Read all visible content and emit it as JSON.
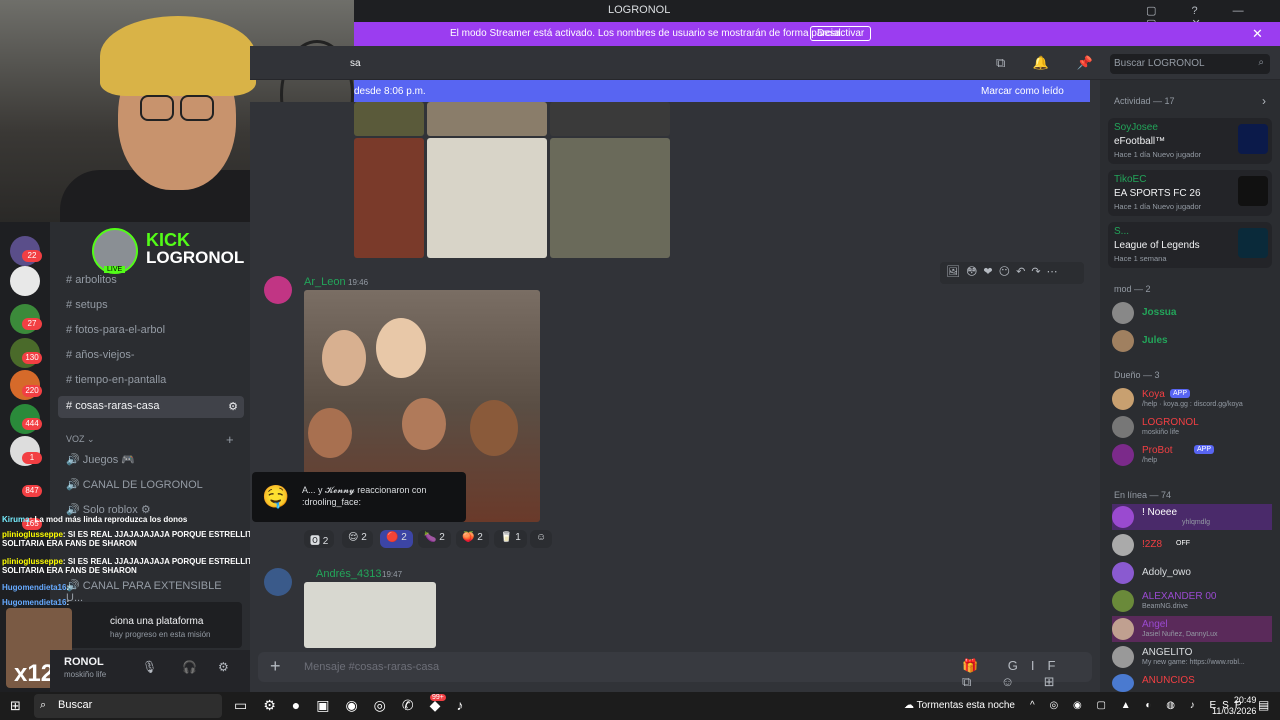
{
  "window": {
    "title": "LOGRONOL",
    "controls": [
      "▢",
      "?",
      "—",
      "▢",
      "✕"
    ]
  },
  "streamer_banner": {
    "message": "El modo Streamer está activado. Los nombres de usuario se mostrarán de forma parcial.",
    "button": "Desactivar",
    "close": "✕"
  },
  "header": {
    "channel_fragment": "sa",
    "search_placeholder": "Buscar LOGRONOL"
  },
  "new_messages_bar": {
    "left": "desde 8:06 p.m.",
    "right": "Marcar como leído"
  },
  "kick_overlay": {
    "brand": "KICK",
    "name": "LOGRONOL",
    "live": "LIVE"
  },
  "server_badges": [
    "22",
    "",
    "27",
    "130",
    "220",
    "444",
    "1",
    "847",
    "165"
  ],
  "channels": [
    {
      "name": "arbolitos",
      "icon": "#"
    },
    {
      "name": "setups",
      "icon": "#"
    },
    {
      "name": "fotos-para-el-arbol",
      "icon": "#"
    },
    {
      "name": "años-viejos-",
      "icon": "#"
    },
    {
      "name": "tiempo-en-pantalla",
      "icon": "#"
    },
    {
      "name": "cosas-raras-casa",
      "icon": "#",
      "selected": true
    }
  ],
  "voice_category": "VOZ",
  "voice_channels": [
    "Juegos 🎮",
    "CANAL DE LOGRONOL",
    "Solo roblox ⚙",
    "CANAL PARA EXTENSIBLE U..."
  ],
  "overlay_chat": [
    {
      "user": "Kiruma",
      "text": ": La mod más linda reproduzca los donos"
    },
    {
      "user": "plinioglusseppe",
      "text": ": SI ES REAL JJAJAJAJAJA PORQUE ESTRELLITA SOLITARIA ERA FANS DE SHARON"
    },
    {
      "user": "plinioglusseppe",
      "text": ": SI ES REAL JJAJAJAJAJA PORQUE ESTRELLITA SOLITARIA ERA FANS DE SHARON"
    },
    {
      "user": "Hugomendieta16",
      "text": ": "
    },
    {
      "user": "Hugomendieta16",
      "text": ": "
    }
  ],
  "mission": {
    "title": "ciona una plataforma",
    "sub": "hay progreso en esta misión",
    "multiplier": "x12"
  },
  "user_panel": {
    "name": "RONOL",
    "status": "moskiño life"
  },
  "messages": [
    {
      "author": "Ar_Leon",
      "time": "19:46"
    },
    {
      "author": "Andrés_4313",
      "time": "19:47"
    }
  ],
  "reactions": [
    {
      "emoji": "🅾",
      "count": "2"
    },
    {
      "emoji": "😌",
      "count": "2"
    },
    {
      "emoji": "🔴",
      "count": "2"
    },
    {
      "emoji": "🍆",
      "count": "2"
    },
    {
      "emoji": "🍑",
      "count": "2"
    },
    {
      "emoji": "🥛",
      "count": "1"
    }
  ],
  "reaction_tooltip": {
    "text": "A... y 𝓚𝓮𝓷𝓷𝔂 reaccionaron con :drooling_face:"
  },
  "composer": {
    "placeholder": "Mensaje #cosas-raras-casa"
  },
  "members": {
    "activity_header": "Actividad — 17",
    "activities": [
      {
        "user": "SoyJosee",
        "game": "eFootball™",
        "meta": "Hace 1 día  Nuevo jugador"
      },
      {
        "user": "TikoEC",
        "game": "EA SPORTS FC 26",
        "meta": "Hace 1 día  Nuevo jugador"
      },
      {
        "user": "S...",
        "game": "League of Legends",
        "meta": "Hace 1 semana"
      }
    ],
    "mod_header": "mod — 2",
    "mods": [
      {
        "name": "Jossua",
        "status": ""
      },
      {
        "name": "Jules",
        "status": ""
      }
    ],
    "owner_header": "Dueño — 3",
    "owners": [
      {
        "name": "Koya",
        "badge": "APP",
        "status": "/help · koya.gg : discord.gg/koya"
      },
      {
        "name": "LOGRONOL",
        "badge": "",
        "status": "moskiño life"
      },
      {
        "name": "ProBot",
        "badge": "APP",
        "status": "/help"
      }
    ],
    "online_header": "En línea — 74",
    "online": [
      {
        "name": "! Noeee",
        "status": "yhlqmdlg"
      },
      {
        "name": "!2Z8",
        "status": "OFF"
      },
      {
        "name": "Adoly_owo",
        "status": ""
      },
      {
        "name": "ALEXANDER 00",
        "status": "BeamNG.drive"
      },
      {
        "name": "Angel",
        "status": "Jasiel Nuñez, DannyLux"
      },
      {
        "name": "ANGELITO",
        "status": "My new game: https://www.robl..."
      },
      {
        "name": "ANUNCIOS",
        "status": ""
      }
    ]
  },
  "taskbar": {
    "search": "Buscar",
    "weather": "Tormentas esta noche",
    "lang": "ESP",
    "time": "20:49",
    "date": "11/03/2026",
    "whatsapp_badge": "99+"
  }
}
